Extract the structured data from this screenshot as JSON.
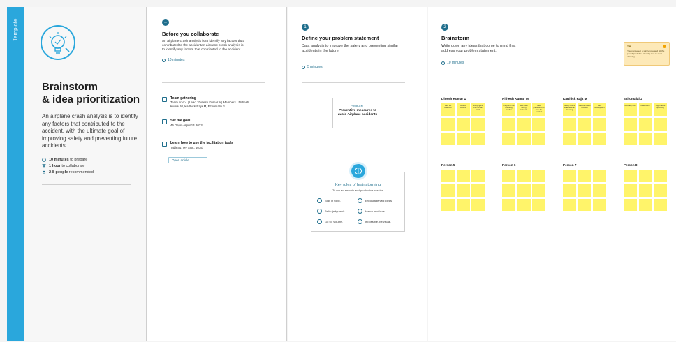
{
  "ribbon": {
    "label": "Template"
  },
  "intro": {
    "title_line1": "Brainstorm",
    "title_line2": "& idea prioritization",
    "description": "An airplane crash analysis is to identify any factors that contributed to the accident, with the ultimate goal of improving safety and preventing future accidents",
    "meta": [
      {
        "icon": "clock-icon",
        "bold": "10 minutes",
        "rest": " to prepare"
      },
      {
        "icon": "hourglass-icon",
        "bold": "1 hour",
        "rest": " to collaborate"
      },
      {
        "icon": "people-icon",
        "bold": "2-8 people",
        "rest": " recommended"
      }
    ]
  },
  "before": {
    "step": "→",
    "title": "Before you collaborate",
    "desc": "An airplane crash analysis is to identify any factors that contributed to the accidentan airplane crash analysis is to identify any factors that contributed to the accident",
    "time": "10 minutes",
    "items": [
      {
        "title": "Team gathering",
        "text": "Team size:4 | Lead : Dinesh Kumar A | Members : Nithesh Kumar M, Karthick Raja M, Ezhumalai J"
      },
      {
        "title": "Set the goal",
        "text": "45 Days - April 14 2023"
      },
      {
        "title": "Learn how to use the facilitation tools",
        "text": "Tableau, My SQL, Word"
      }
    ],
    "open_label": "Open article",
    "open_arrow": "→"
  },
  "define": {
    "step": "1",
    "title": "Define your problem statement",
    "desc": "Data analysis to improve the safety and preventing similar accidents in the future",
    "time": "5 minutes",
    "card_label": "PROBLEM",
    "card_value": "Preventive measures to avoid Airplane accidents",
    "rules_title": "Key rules of brainstorming",
    "rules_sub": "To run an smooth and productive session",
    "rules": [
      "Stay in topic.",
      "Encourage wild ideas.",
      "Defer judgment.",
      "Listen to others.",
      "Go for volume.",
      "If possible, be visual."
    ]
  },
  "brainstorm": {
    "step": "2",
    "title": "Brainstorm",
    "desc": "Write down any ideas that come to mind that address your problem statement.",
    "time": "10 minutes",
    "tip_label": "TIP",
    "tip_text": "You can select a sticky note and hit the pencil (switch to sketch) icon to start drawing!",
    "people": [
      {
        "name": "Dinesh Kumar U",
        "notes": [
          "Data set collection",
          "Accident causes",
          "Studying the crash impact details"
        ]
      },
      {
        "name": "Nithesh Kumar M",
        "notes": [
          "Analysis of the operating crashes",
          "Safe rules during accidents",
          "Safe precautions to save the accident"
        ]
      },
      {
        "name": "Karthick Raja M",
        "notes": [
          "Safety factors of airplane air traveling",
          "Weather based accident",
          "Data development"
        ]
      },
      {
        "name": "Ezhumalai J",
        "notes": [
          "Accuracy level",
          "Data import",
          "Flight based operating"
        ]
      },
      {
        "name": "Person 5",
        "notes": []
      },
      {
        "name": "Person 6",
        "notes": []
      },
      {
        "name": "Person 7",
        "notes": []
      },
      {
        "name": "Person 8",
        "notes": []
      }
    ]
  }
}
